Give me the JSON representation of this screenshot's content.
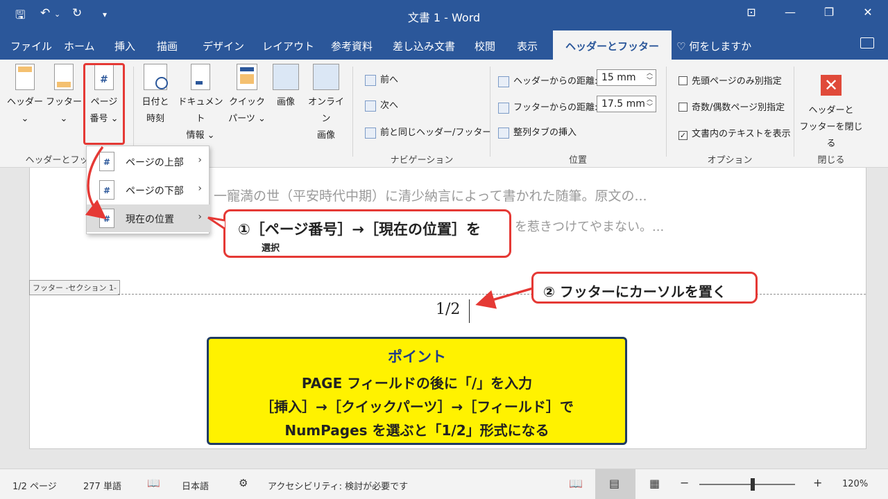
{
  "titlebar": {
    "title": "文書 1  -  Word",
    "save_icon": "save-icon",
    "undo_icon": "undo-icon",
    "redo_icon": "redo-icon"
  },
  "tabs": [
    {
      "label": "ファイル"
    },
    {
      "label": "ホーム"
    },
    {
      "label": "挿入"
    },
    {
      "label": "描画"
    },
    {
      "label": "デザイン"
    },
    {
      "label": "レイアウト"
    },
    {
      "label": "参考資料"
    },
    {
      "label": "差し込み文書"
    },
    {
      "label": "校閲"
    },
    {
      "label": "表示"
    },
    {
      "label": "ヘッダーとフッター"
    }
  ],
  "tell_me": "何をしますか",
  "ribbon": {
    "header_l1": "ヘッダー",
    "footer_l1": "フッター",
    "pagenum_l1": "ページ",
    "pagenum_l2": "番号",
    "group1": "ヘッダーとフッター",
    "datetime_l1": "日付と",
    "datetime_l2": "時刻",
    "docinfo_l1": "ドキュメント",
    "docinfo_l2": "情報",
    "quick_l1": "クイック",
    "quick_l2": "パーツ",
    "picture": "画像",
    "online_l1": "オンライン",
    "online_l2": "画像",
    "prev": "前へ",
    "next": "次へ",
    "link_prev": "前と同じヘッダー/フッター",
    "group_nav": "ナビゲーション",
    "header_dist_label": "ヘッダーからの距離:",
    "header_dist_value": "15 mm",
    "footer_dist_label": "フッターからの距離:",
    "footer_dist_value": "17.5 mm",
    "align_tab": "整列タブの挿入",
    "group_pos": "位置",
    "opt_first": "先頭ページのみ別指定",
    "opt_oddeven": "奇数/偶数ページ別指定",
    "opt_show": "文書内のテキストを表示",
    "group_opt": "オプション",
    "close_l1": "ヘッダーと",
    "close_l2": "フッターを閉じる",
    "group_close": "閉じる"
  },
  "menu": {
    "top": "ページの上部",
    "bottom": "ページの下部",
    "current": "現在の位置"
  },
  "document": {
    "line1": "一寵満の世（平安時代中期）に清少納言によって書かれた随筆。原文の...",
    "line2": "を惹きつけてやまない。...",
    "footer_tag": "フッター -セクション 1-",
    "page_number": "1/2"
  },
  "callouts": {
    "c1_main": "①［ページ番号］→［現在の位置］を",
    "c1_sub": "選択",
    "c2": "② フッターにカーソルを置く",
    "point_title": "ポイント",
    "point_l1": "PAGE フィールドの後に「/」を入力",
    "point_l2": "［挿入］→［クイックパーツ］→［フィールド］で",
    "point_l3": "NumPages を選ぶと「1/2」形式になる"
  },
  "status": {
    "page": "1/2 ページ",
    "words": "277 単語",
    "lang": "日本語",
    "access": "アクセシビリティ: 検討が必要です",
    "zoom": "120%"
  },
  "colors": {
    "brand": "#2b579a",
    "highlight": "#e53935",
    "point_bg": "#fff200"
  }
}
